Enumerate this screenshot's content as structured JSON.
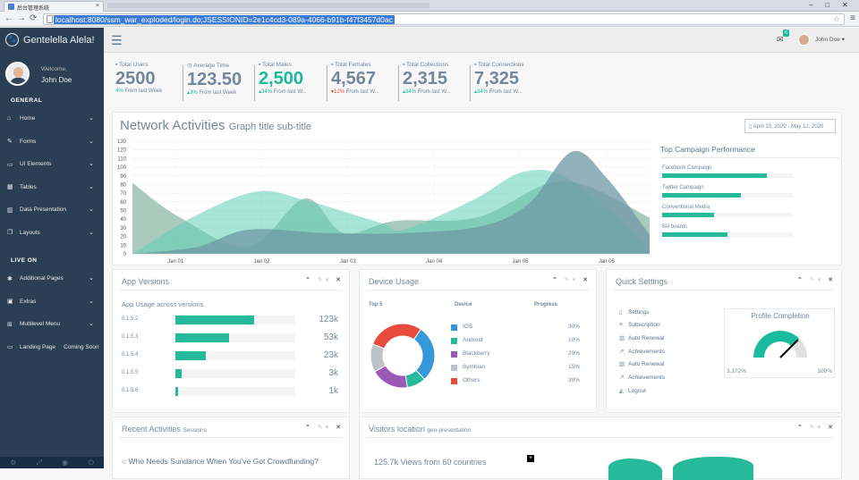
{
  "browser": {
    "tab_title": "后台管理系统",
    "url": "localhost:8080/ssm_war_exploded/login.do;JSESSIONID=2e1c4cd3-089a-4066-b91b-f47f3457d0ac"
  },
  "sidebar": {
    "brand": "Gentelella Alela!",
    "welcome": "Welcome,",
    "user": "John Doe",
    "general_label": "GENERAL",
    "general_items": [
      {
        "label": "Home",
        "icon": "home-icon"
      },
      {
        "label": "Forms",
        "icon": "edit-icon"
      },
      {
        "label": "UI Elements",
        "icon": "desktop-icon"
      },
      {
        "label": "Tables",
        "icon": "table-icon"
      },
      {
        "label": "Data Presentation",
        "icon": "bar-chart-icon"
      },
      {
        "label": "Layouts",
        "icon": "clone-icon"
      }
    ],
    "live_label": "LIVE ON",
    "live_items": [
      {
        "label": "Additional Pages",
        "icon": "bug-icon"
      },
      {
        "label": "Extras",
        "icon": "windows-icon"
      },
      {
        "label": "Multilevel Menu",
        "icon": "sitemap-icon"
      },
      {
        "label": "Landing Page",
        "icon": "laptop-icon",
        "extra": "Coming Soon"
      }
    ]
  },
  "topnav": {
    "mail_badge": "6",
    "user": "John Doe"
  },
  "stats": [
    {
      "label": "Total Users",
      "value": "2500",
      "pct": "4%",
      "trend": "",
      "sub": "From last Week",
      "green": false,
      "red": false
    },
    {
      "label": "Average Time",
      "value": "123.50",
      "pct": "3%",
      "trend": "up",
      "sub": "From last Week",
      "green": false,
      "red": false
    },
    {
      "label": "Total Males",
      "value": "2,500",
      "pct": "34%",
      "trend": "up",
      "sub": "From last W...",
      "green": true,
      "red": false
    },
    {
      "label": "Total Females",
      "value": "4,567",
      "pct": "12%",
      "trend": "down",
      "sub": "From last W...",
      "green": false,
      "red": true
    },
    {
      "label": "Total Collections",
      "value": "2,315",
      "pct": "34%",
      "trend": "up",
      "sub": "From last W...",
      "green": false,
      "red": false
    },
    {
      "label": "Total Connections",
      "value": "7,325",
      "pct": "34%",
      "trend": "up",
      "sub": "From last W...",
      "green": false,
      "red": false
    }
  ],
  "network": {
    "title": "Network Activities",
    "subtitle": "Graph title sub-title",
    "daterange": "April 13, 2020 - May 12, 2020"
  },
  "chart_data": {
    "type": "area",
    "title": "Network Activities",
    "xlabel": "",
    "ylabel": "",
    "ylim": [
      0,
      130
    ],
    "yticks": [
      0,
      10,
      20,
      30,
      40,
      50,
      60,
      70,
      80,
      90,
      100,
      110,
      120,
      130
    ],
    "xticks": [
      "Jan 01",
      "Jan 02",
      "Jan 03",
      "Jan 04",
      "Jan 05",
      "Jan 06"
    ],
    "grid": true,
    "series": [
      {
        "color": "#96CA59",
        "x": [
          0,
          0.55,
          1.35,
          2.0,
          2.45,
          3.05,
          4.0,
          5.0,
          6.0
        ],
        "values": [
          82,
          42,
          8,
          64,
          24,
          38,
          42,
          84,
          42
        ]
      },
      {
        "color": "#26B99A",
        "x": [
          0,
          0.75,
          1.45,
          2.0,
          2.9,
          3.15,
          3.95,
          4.55,
          5.1,
          6.0
        ],
        "values": [
          0,
          45,
          72,
          62,
          35,
          28,
          62,
          95,
          84,
          8
        ]
      },
      {
        "color": "#3F97EB",
        "x": [
          0,
          0.75,
          1.35,
          2.25,
          3.15,
          4.05,
          4.6,
          5.1,
          5.5,
          6.0
        ],
        "values": [
          0,
          8,
          28,
          24,
          24,
          32,
          58,
          118,
          88,
          22
        ]
      }
    ]
  },
  "campaign": {
    "title": "Top Campaign Performance",
    "items": [
      {
        "label": "Facebook Campaign",
        "fill": 0.8
      },
      {
        "label": "Twitter Campaign",
        "fill": 0.6
      },
      {
        "label": "Conventional Media",
        "fill": 0.4
      },
      {
        "label": "Bill boards",
        "fill": 0.5
      }
    ]
  },
  "app_versions": {
    "title": "App Versions",
    "subtitle": "App Usage across versions",
    "rows": [
      {
        "version": "0.1.5.2",
        "value": "123k",
        "fill": 0.66
      },
      {
        "version": "0.1.5.3",
        "value": "53k",
        "fill": 0.45
      },
      {
        "version": "0.1.5.4",
        "value": "23k",
        "fill": 0.25
      },
      {
        "version": "0.1.5.5",
        "value": "3k",
        "fill": 0.05
      },
      {
        "version": "0.1.5.6",
        "value": "1k",
        "fill": 0.02
      }
    ]
  },
  "device_usage": {
    "title": "Device Usage",
    "top_label": "Top 5",
    "device_col": "Device",
    "progress_col": "Progress",
    "rows": [
      {
        "name": "IOS",
        "pct": "30%",
        "color": "#3498DB"
      },
      {
        "name": "Android",
        "pct": "10%",
        "color": "#26B99A"
      },
      {
        "name": "Blackberry",
        "pct": "20%",
        "color": "#9B59B6"
      },
      {
        "name": "Symbian",
        "pct": "15%",
        "color": "#BDC3C7"
      },
      {
        "name": "Others",
        "pct": "30%",
        "color": "#E74C3C"
      }
    ]
  },
  "quick_settings": {
    "title": "Quick Settings",
    "items": [
      {
        "label": "Settings",
        "icon": "calendar-icon"
      },
      {
        "label": "Subscription",
        "icon": "bars-icon"
      },
      {
        "label": "Auto Renewal",
        "icon": "bar-chart-icon"
      },
      {
        "label": "Achievements",
        "icon": "line-chart-icon"
      },
      {
        "label": "Auto Renewal",
        "icon": "bar-chart-icon"
      },
      {
        "label": "Achievements",
        "icon": "line-chart-icon"
      },
      {
        "label": "Logout",
        "icon": "area-chart-icon"
      }
    ],
    "profile_title": "Profile Completion",
    "min": "3,172%",
    "max": "100%",
    "completion": 0.75
  },
  "recent": {
    "title": "Recent Activities",
    "subtitle": "Sessions",
    "item": "Who Needs Sundance When You've Got Crowdfunding?"
  },
  "visitors": {
    "title": "Visitors location",
    "subtitle": "geo-presentation",
    "views": "125.7k Views from 60 countries"
  }
}
